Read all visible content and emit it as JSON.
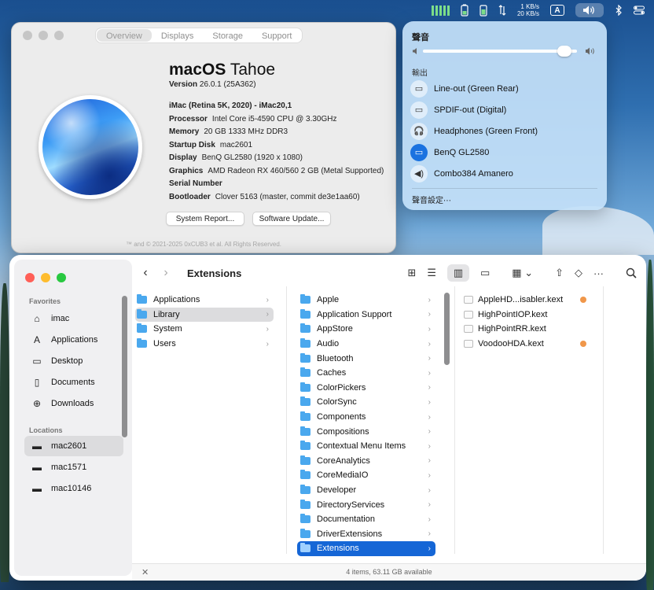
{
  "menubar": {
    "net_up": "1 KB/s",
    "net_down": "20 KB/s",
    "input_indicator": "A"
  },
  "about": {
    "tabs": [
      "Overview",
      "Displays",
      "Storage",
      "Support"
    ],
    "title_bold": "macOS",
    "title_light": "Tahoe",
    "version_label": "Version",
    "version_value": "26.0.1 (25A362)",
    "model": "iMac (Retina 5K, 2020) - iMac20,1",
    "specs": [
      {
        "key": "Processor",
        "value": "Intel Core i5-4590 CPU @ 3.30GHz"
      },
      {
        "key": "Memory",
        "value": "20 GB 1333 MHz DDR3"
      },
      {
        "key": "Startup Disk",
        "value": "mac2601"
      },
      {
        "key": "Display",
        "value": "BenQ GL2580 (1920 x 1080)"
      },
      {
        "key": "Graphics",
        "value": "AMD Radeon RX 460/560 2 GB (Metal Supported)"
      },
      {
        "key": "Serial Number",
        "value": ""
      },
      {
        "key": "Bootloader",
        "value": "Clover 5163 (master, commit de3e1aa60)"
      }
    ],
    "system_report_button": "System Report...",
    "software_update_button": "Software Update...",
    "footer": "™ and © 2021-2025 0xCUB3 et al. All Rights Reserved."
  },
  "sound": {
    "title": "聲音",
    "volume_level": 0.92,
    "output_section": "輸出",
    "devices": [
      {
        "label": "Line-out (Green Rear)",
        "icon": "display-icon",
        "active": false
      },
      {
        "label": "SPDIF-out (Digital)",
        "icon": "display-icon",
        "active": false
      },
      {
        "label": "Headphones (Green Front)",
        "icon": "headphones-icon",
        "active": false
      },
      {
        "label": "BenQ GL2580",
        "icon": "display-icon",
        "active": true
      },
      {
        "label": "Combo384 Amanero",
        "icon": "speaker-icon",
        "active": false
      }
    ],
    "settings_link": "聲音設定⋯"
  },
  "finder": {
    "title": "Extensions",
    "sidebar": {
      "favorites_header": "Favorites",
      "favorites": [
        {
          "label": "imac",
          "icon": "home-icon"
        },
        {
          "label": "Applications",
          "icon": "applications-icon"
        },
        {
          "label": "Desktop",
          "icon": "desktop-icon"
        },
        {
          "label": "Documents",
          "icon": "document-icon"
        },
        {
          "label": "Downloads",
          "icon": "download-icon"
        }
      ],
      "locations_header": "Locations",
      "locations": [
        {
          "label": "mac2601",
          "icon": "drive-icon",
          "selected": true
        },
        {
          "label": "mac1571",
          "icon": "drive-icon",
          "selected": false
        },
        {
          "label": "mac10146",
          "icon": "drive-icon",
          "selected": false
        }
      ]
    },
    "column1": [
      "Applications",
      "Library",
      "System",
      "Users"
    ],
    "column2": [
      "Apple",
      "Application Support",
      "AppStore",
      "Audio",
      "Bluetooth",
      "Caches",
      "ColorPickers",
      "ColorSync",
      "Components",
      "Compositions",
      "Contextual Menu Items",
      "CoreAnalytics",
      "CoreMediaIO",
      "Developer",
      "DirectoryServices",
      "Documentation",
      "DriverExtensions",
      "Extensions"
    ],
    "column3": [
      {
        "label": "AppleHD...isabler.kext",
        "tagged": true
      },
      {
        "label": "HighPointIOP.kext",
        "tagged": false
      },
      {
        "label": "HighPointRR.kext",
        "tagged": false
      },
      {
        "label": "VoodooHDA.kext",
        "tagged": true
      }
    ],
    "status": "4 items, 63.11 GB available"
  },
  "colors": {
    "accent": "#1566d6",
    "folder": "#4aa8ee",
    "tag_orange": "#f0974a",
    "close": "#ff5f57",
    "minimize": "#febc2e",
    "zoom": "#28c840"
  }
}
